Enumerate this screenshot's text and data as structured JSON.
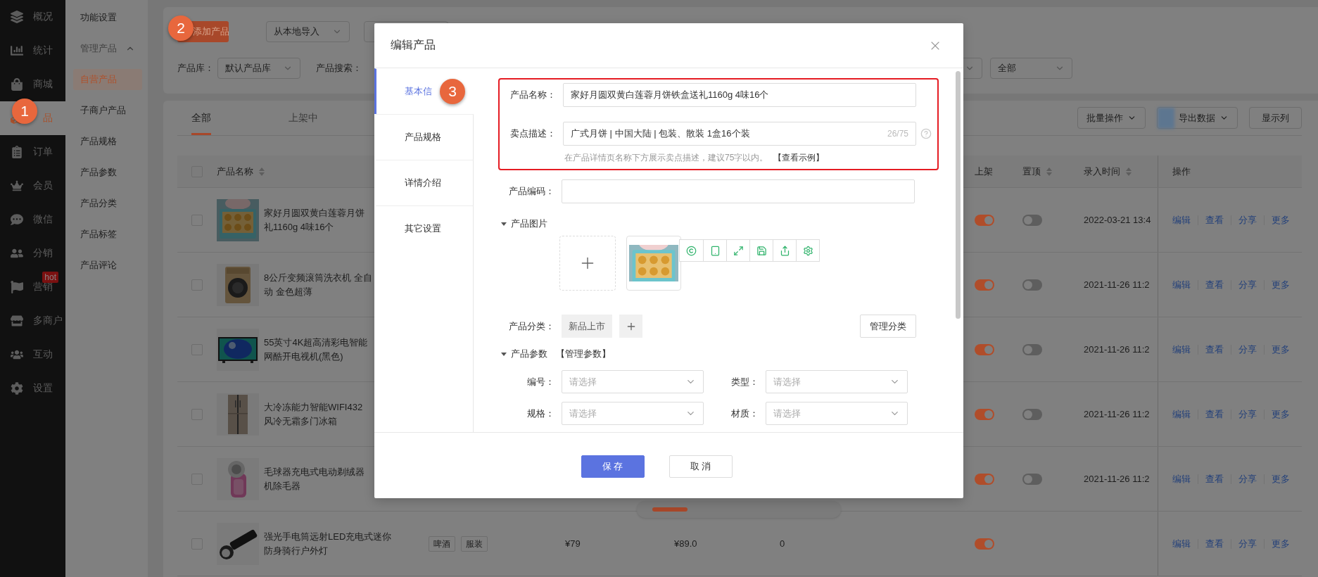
{
  "sidebar": {
    "items": [
      {
        "label": "概况",
        "selected": false
      },
      {
        "label": "统计",
        "selected": false
      },
      {
        "label": "商城",
        "selected": false
      },
      {
        "label": "品",
        "selected": true
      },
      {
        "label": "订单",
        "selected": false
      },
      {
        "label": "会员",
        "selected": false
      },
      {
        "label": "微信",
        "selected": false
      },
      {
        "label": "分销",
        "selected": false
      },
      {
        "label": "营销",
        "selected": false,
        "badge": "hot"
      },
      {
        "label": "多商户",
        "selected": false
      },
      {
        "label": "互动",
        "selected": false
      },
      {
        "label": "设置",
        "selected": false
      }
    ]
  },
  "submenu": {
    "items": [
      {
        "label": "功能设置",
        "kind": "link",
        "selected": false
      },
      {
        "label": "管理产品",
        "kind": "group",
        "expanded": true
      },
      {
        "label": "自营产品",
        "kind": "link",
        "selected": true
      },
      {
        "label": "子商户产品",
        "kind": "link",
        "selected": false
      },
      {
        "label": "产品规格",
        "kind": "link",
        "selected": false
      },
      {
        "label": "产品参数",
        "kind": "link",
        "selected": false
      },
      {
        "label": "产品分类",
        "kind": "link",
        "selected": false
      },
      {
        "label": "产品标签",
        "kind": "link",
        "selected": false
      },
      {
        "label": "产品评论",
        "kind": "link",
        "selected": false
      }
    ]
  },
  "toolbar": {
    "add_button": "添加产品",
    "import_select": "从本地导入",
    "library_label": "产品库：",
    "library_select": "默认产品库",
    "search_label": "产品搜索：",
    "status_select": "全部"
  },
  "tabs": [
    {
      "label": "全部",
      "selected": true
    },
    {
      "label": "上架中",
      "selected": false
    }
  ],
  "table_actions": [
    {
      "label": "批量操作",
      "kind": "dropdown"
    },
    {
      "label": "导出数据",
      "kind": "export"
    },
    {
      "label": "显示列",
      "kind": "button"
    }
  ],
  "table": {
    "select_all_checked": false,
    "columns": [
      {
        "label": "产品名称",
        "sortable": true
      },
      {
        "label": "上架",
        "sortable": false
      },
      {
        "label": "置顶",
        "sortable": true
      },
      {
        "label": "录入时间",
        "sortable": true
      },
      {
        "label": "操作",
        "sortable": false
      }
    ],
    "rows": [
      {
        "checked": false,
        "name": [
          "家好月圆双黄白莲蓉月饼",
          "礼1160g  4味16个"
        ],
        "listed": true,
        "pinned": false,
        "created": "2022-03-21 13:4",
        "actions": [
          "编辑",
          "查看",
          "分享",
          "更多"
        ]
      },
      {
        "checked": false,
        "name": [
          "8公斤变频滚筒洗衣机 全自",
          "动 金色超薄"
        ],
        "listed": true,
        "pinned": false,
        "created": "2021-11-26 11:2",
        "actions": [
          "编辑",
          "查看",
          "分享",
          "更多"
        ]
      },
      {
        "checked": false,
        "name": [
          "55英寸4K超高清彩电智能",
          "网酷开电视机(黑色)"
        ],
        "listed": true,
        "pinned": false,
        "created": "2021-11-26 11:2",
        "actions": [
          "编辑",
          "查看",
          "分享",
          "更多"
        ]
      },
      {
        "checked": false,
        "name": [
          "大冷冻能力智能WIFI432",
          "风冷无霜多门冰箱"
        ],
        "listed": true,
        "pinned": false,
        "created": "2021-11-26 11:2",
        "actions": [
          "编辑",
          "查看",
          "分享",
          "更多"
        ]
      },
      {
        "checked": false,
        "name": [
          "毛球器充电式电动剃绒器",
          "机除毛器"
        ],
        "listed": true,
        "pinned": false,
        "created": "2021-11-26 11:2",
        "actions": [
          "编辑",
          "查看",
          "分享",
          "更多"
        ]
      },
      {
        "checked": false,
        "name": [
          "强光手电筒远射LED充电式迷你",
          "防身骑行户外灯"
        ],
        "tags": [
          "啤酒",
          "服装"
        ],
        "price": "¥79",
        "market_price": "¥89.0",
        "stock": "0",
        "listed": true,
        "actions": [
          "编辑",
          "查看",
          "分享",
          "更多"
        ]
      }
    ]
  },
  "dialog": {
    "title": "编辑产品",
    "tabs": [
      {
        "label": "基本信",
        "selected": true
      },
      {
        "label": "产品规格",
        "selected": false
      },
      {
        "label": "详情介绍",
        "selected": false
      },
      {
        "label": "其它设置",
        "selected": false
      }
    ],
    "name_field": {
      "label": "产品名称：",
      "value": "家好月圆双黄白莲蓉月饼铁盒送礼1160g  4味16个"
    },
    "selling_field": {
      "label": "卖点描述：",
      "value": "广式月饼 | 中国大陆 | 包装、散装 1盒16个装",
      "counter": "26/75",
      "hint": "在产品详情页名称下方展示卖点描述，建议75字以内。",
      "hint_link": "【查看示例】"
    },
    "code_field": {
      "label": "产品编码："
    },
    "images_section": {
      "title": "产品图片",
      "expanded": true
    },
    "category": {
      "label": "产品分类：",
      "tags": [
        "新品上市"
      ],
      "manage_button": "管理分类"
    },
    "params_section": {
      "title": "产品参数",
      "expanded": true,
      "link": "【管理参数】"
    },
    "params": [
      {
        "label": "编号：",
        "placeholder": "请选择"
      },
      {
        "label": "类型：",
        "placeholder": "请选择"
      },
      {
        "label": "规格：",
        "placeholder": "请选择"
      },
      {
        "label": "材质：",
        "placeholder": "请选择"
      }
    ],
    "buttons": [
      {
        "label": "保 存",
        "kind": "primary"
      },
      {
        "label": "取 消",
        "kind": "default"
      }
    ]
  },
  "guide_badges": [
    "1",
    "2",
    "3"
  ]
}
